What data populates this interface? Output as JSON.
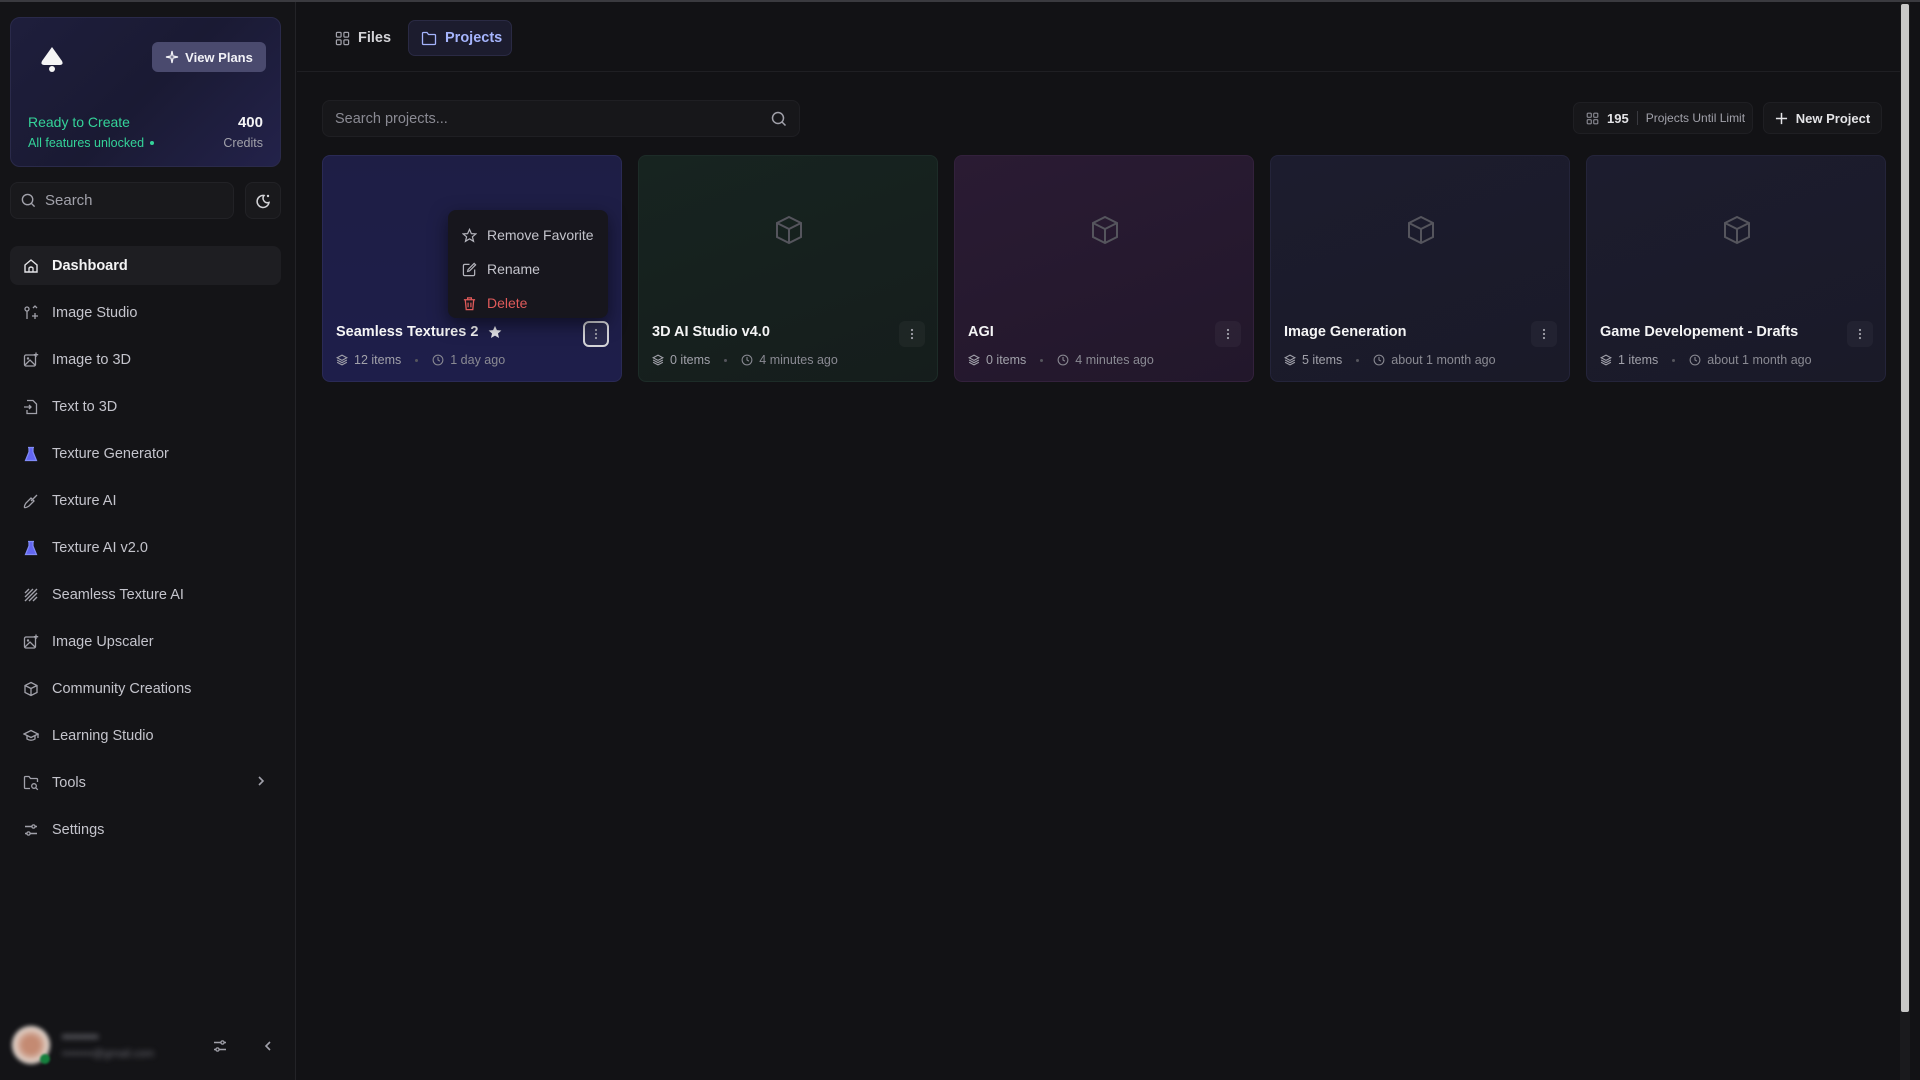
{
  "sidebar": {
    "promo": {
      "view_plans_label": "View Plans",
      "status_title": "Ready to Create",
      "status_subtitle": "All features unlocked",
      "credits_value": "400",
      "credits_label": "Credits",
      "accent_color": "#34d399"
    },
    "search_placeholder": "Search",
    "nav_items": [
      {
        "label": "Dashboard",
        "icon": "home-icon",
        "active": true
      },
      {
        "label": "Image Studio",
        "icon": "image-studio-icon"
      },
      {
        "label": "Image to 3D",
        "icon": "image-plus-icon"
      },
      {
        "label": "Text to 3D",
        "icon": "file-import-icon"
      },
      {
        "label": "Texture Generator",
        "icon": "flask-icon"
      },
      {
        "label": "Texture AI",
        "icon": "paintbrush-icon"
      },
      {
        "label": "Texture AI v2.0",
        "icon": "flask-icon"
      },
      {
        "label": "Seamless Texture AI",
        "icon": "hatch-pattern-icon"
      },
      {
        "label": "Image Upscaler",
        "icon": "image-plus-icon"
      },
      {
        "label": "Community Creations",
        "icon": "cube-icon"
      },
      {
        "label": "Learning Studio",
        "icon": "graduation-cap-icon"
      },
      {
        "label": "Tools",
        "icon": "folder-search-icon",
        "has_submenu": true
      },
      {
        "label": "Settings",
        "icon": "sliders-icon"
      }
    ],
    "user": {
      "name": "••••••••",
      "email": "••••••••@gmail.com"
    }
  },
  "tabs": [
    {
      "label": "Files",
      "icon": "grid-icon",
      "active": false
    },
    {
      "label": "Projects",
      "icon": "folder-icon",
      "active": true
    }
  ],
  "search": {
    "placeholder": "Search projects...",
    "value": ""
  },
  "limit": {
    "count": "195",
    "label": "Projects Until Limit"
  },
  "new_project_label": "New Project",
  "projects": [
    {
      "title": "Seamless Textures 2",
      "favorite": true,
      "items": "12 items",
      "updated": "1 day ago",
      "theme": "blue"
    },
    {
      "title": "3D AI Studio v4.0",
      "favorite": false,
      "items": "0 items",
      "updated": "4 minutes ago",
      "theme": "green"
    },
    {
      "title": "AGI",
      "favorite": false,
      "items": "0 items",
      "updated": "4 minutes ago",
      "theme": "purple"
    },
    {
      "title": "Image Generation",
      "favorite": false,
      "items": "5 items",
      "updated": "about 1 month ago",
      "theme": "navy"
    },
    {
      "title": "Game Developement - Drafts",
      "favorite": false,
      "items": "1 items",
      "updated": "about 1 month ago",
      "theme": "navy"
    }
  ],
  "context_menu": {
    "items": [
      {
        "label": "Remove Favorite",
        "icon": "star-outline-icon"
      },
      {
        "label": "Rename",
        "icon": "edit-icon"
      },
      {
        "label": "Delete",
        "icon": "trash-icon",
        "danger": true
      }
    ],
    "danger_color": "#e05a5a"
  }
}
